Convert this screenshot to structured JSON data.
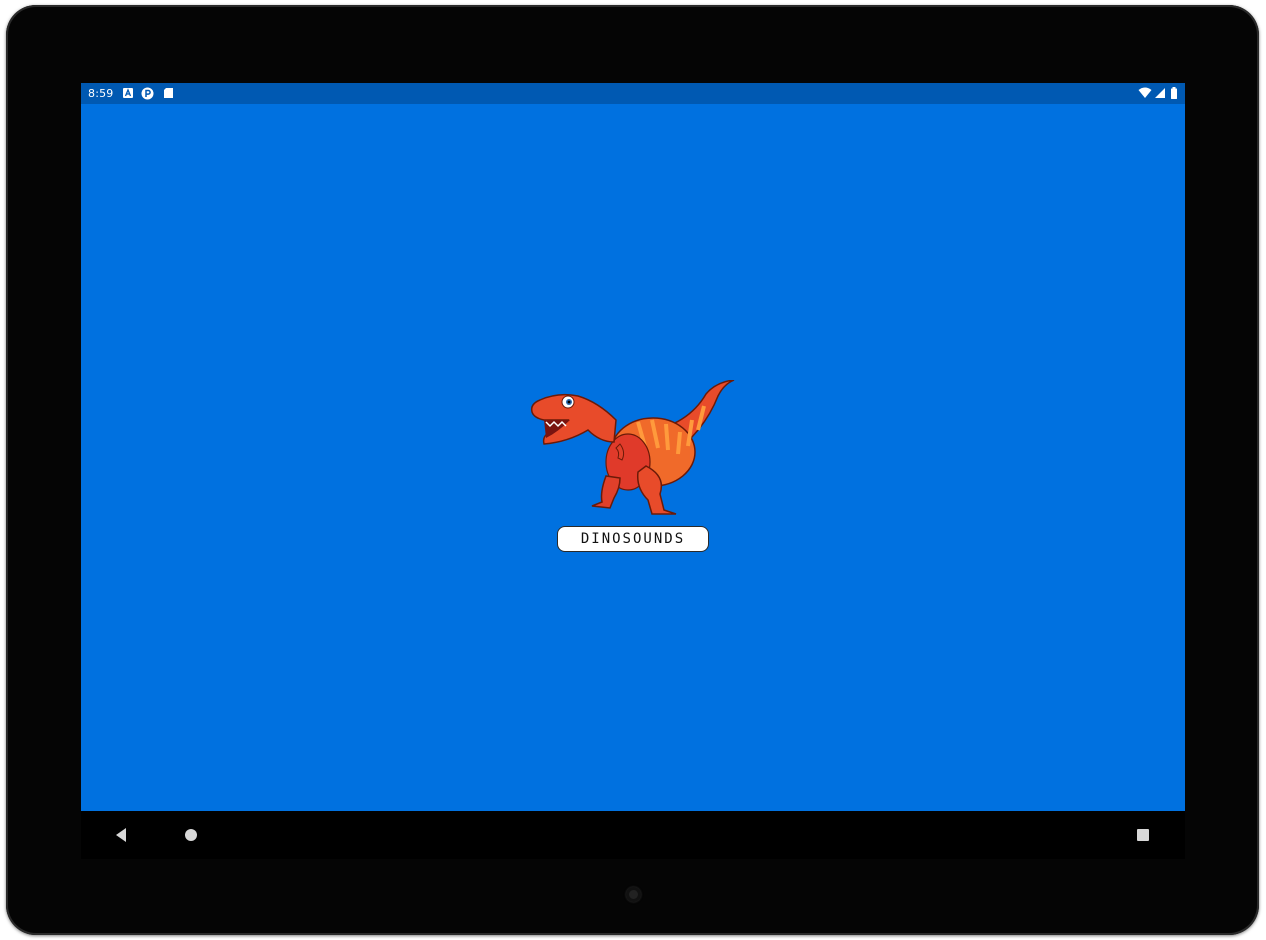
{
  "status_bar": {
    "time": "8:59",
    "left_icons": [
      "notification-a-icon",
      "notification-p-icon",
      "sd-card-icon"
    ],
    "right_icons": [
      "wifi-icon",
      "signal-icon",
      "battery-icon"
    ],
    "color": "#0059b2"
  },
  "app": {
    "background_color": "#0071e0",
    "logo_text": "DINOSOUNDS",
    "mascot": "t-rex-mascot"
  },
  "nav_bar": {
    "buttons": [
      "back-icon",
      "home-icon",
      "recents-icon"
    ]
  }
}
